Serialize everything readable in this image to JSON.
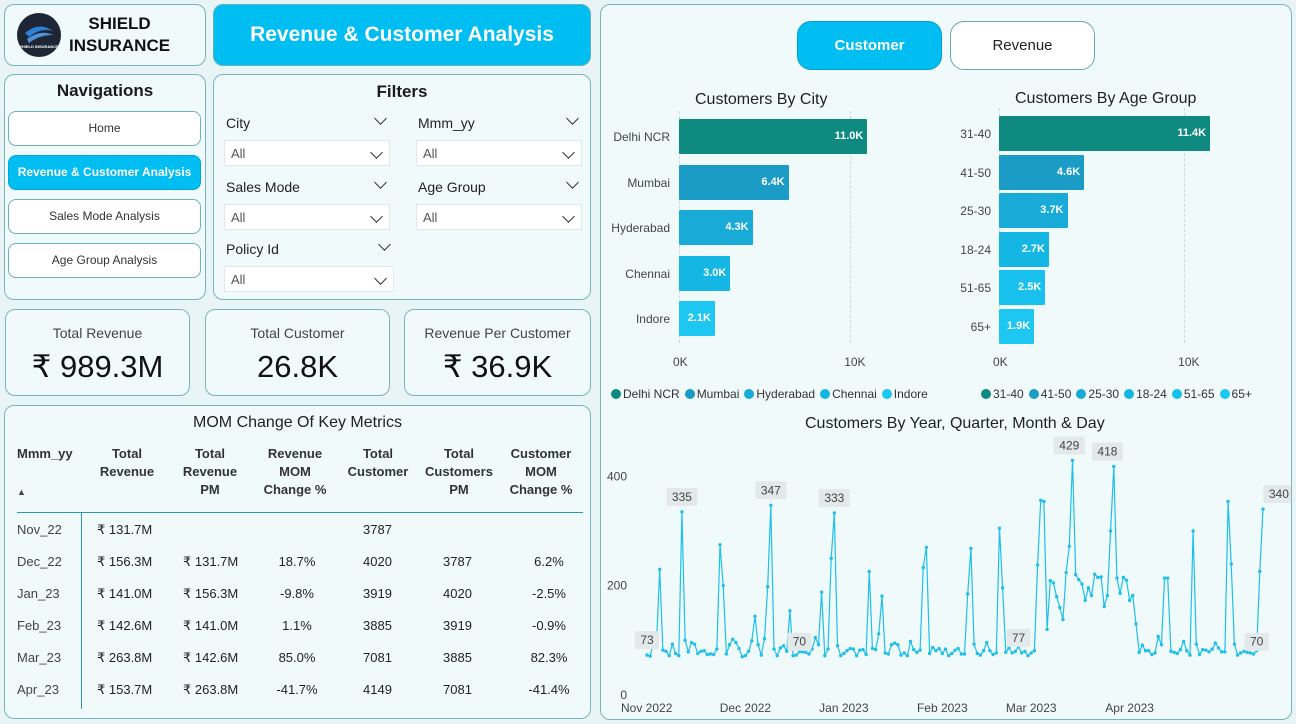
{
  "brand": {
    "name_line1": "SHIELD",
    "name_line2": "INSURANCE",
    "logo_text": "SHIELD INSURANCE"
  },
  "header": {
    "title": "Revenue & Customer Analysis"
  },
  "navigation": {
    "title": "Navigations",
    "items": [
      "Home",
      "Revenue & Customer Analysis",
      "Sales Mode Analysis",
      "Age Group Analysis"
    ],
    "active_index": 1
  },
  "filters": {
    "title": "Filters",
    "city": {
      "label": "City",
      "value": "All"
    },
    "mmm_yy": {
      "label": "Mmm_yy",
      "value": "All"
    },
    "sales_mode": {
      "label": "Sales Mode",
      "value": "All"
    },
    "age_group": {
      "label": "Age Group",
      "value": "All"
    },
    "policy_id": {
      "label": "Policy Id",
      "value": "All"
    }
  },
  "kpis": [
    {
      "label": "Total Revenue",
      "value": "₹ 989.3M"
    },
    {
      "label": "Total Customer",
      "value": "26.8K"
    },
    {
      "label": "Revenue Per Customer",
      "value": "₹ 36.9K"
    }
  ],
  "mom_table": {
    "title": "MOM Change Of Key Metrics",
    "columns": [
      "Mmm_yy",
      "Total Revenue",
      "Total Revenue PM",
      "Revenue MOM Change %",
      "Total Customer",
      "Total Customers PM",
      "Customer MOM Change %"
    ],
    "rows": [
      [
        "Nov_22",
        "₹ 131.7M",
        "",
        "",
        "3787",
        "",
        ""
      ],
      [
        "Dec_22",
        "₹ 156.3M",
        "₹ 131.7M",
        "18.7%",
        "4020",
        "3787",
        "6.2%"
      ],
      [
        "Jan_23",
        "₹ 141.0M",
        "₹ 156.3M",
        "-9.8%",
        "3919",
        "4020",
        "-2.5%"
      ],
      [
        "Feb_23",
        "₹ 142.6M",
        "₹ 141.0M",
        "1.1%",
        "3885",
        "3919",
        "-0.9%"
      ],
      [
        "Mar_23",
        "₹ 263.8M",
        "₹ 142.6M",
        "85.0%",
        "7081",
        "3885",
        "82.3%"
      ],
      [
        "Apr_23",
        "₹ 153.7M",
        "₹ 263.8M",
        "-41.7%",
        "4149",
        "7081",
        "-41.4%"
      ]
    ]
  },
  "toggles": {
    "customer": "Customer",
    "revenue": "Revenue",
    "active": "customer"
  },
  "colors": {
    "accent": "#00bdf2",
    "teal": "#0f8a80",
    "blue": "#1fa3c9",
    "cyan": "#1ec0ea"
  },
  "chart_data": [
    {
      "type": "bar",
      "title": "Customers By City",
      "orientation": "horizontal",
      "categories": [
        "Delhi NCR",
        "Mumbai",
        "Hyderabad",
        "Chennai",
        "Indore"
      ],
      "values": [
        11.0,
        6.4,
        4.3,
        3.0,
        2.1
      ],
      "value_labels": [
        "11.0K",
        "6.4K",
        "4.3K",
        "3.0K",
        "2.1K"
      ],
      "xlim": [
        0,
        12.5
      ],
      "xticks": [
        "0K",
        "10K"
      ],
      "colors": [
        "#0f8a80",
        "#1a9cc6",
        "#18abd8",
        "#14b7e4",
        "#1ec6f2"
      ],
      "legend": [
        "Delhi NCR",
        "Mumbai",
        "Hyderabad",
        "Chennai",
        "Indore"
      ]
    },
    {
      "type": "bar",
      "title": "Customers By Age Group",
      "orientation": "horizontal",
      "categories": [
        "31-40",
        "41-50",
        "25-30",
        "18-24",
        "51-65",
        "65+"
      ],
      "values": [
        11.4,
        4.6,
        3.7,
        2.7,
        2.5,
        1.9
      ],
      "value_labels": [
        "11.4K",
        "4.6K",
        "3.7K",
        "2.7K",
        "2.5K",
        "1.9K"
      ],
      "xlim": [
        0,
        13.5
      ],
      "xticks": [
        "0K",
        "10K"
      ],
      "colors": [
        "#0f8a80",
        "#1a9cc6",
        "#18abd8",
        "#14b7e4",
        "#18c0ee",
        "#1ec6f2"
      ],
      "legend": [
        "31-40",
        "41-50",
        "25-30",
        "18-24",
        "51-65",
        "65+"
      ]
    },
    {
      "type": "line",
      "title": "Customers By Year, Quarter, Month & Day",
      "ylim": [
        0,
        450
      ],
      "yticks": [
        "0",
        "200",
        "400"
      ],
      "xticks": [
        "Nov 2022",
        "Dec 2022",
        "Jan 2023",
        "Feb 2023",
        "Mar 2023",
        "Apr 2023"
      ],
      "values": [
        73,
        71,
        95,
        94,
        230,
        82,
        80,
        72,
        93,
        76,
        72,
        335,
        100,
        79,
        96,
        93,
        76,
        80,
        81,
        74,
        75,
        74,
        84,
        275,
        200,
        75,
        92,
        102,
        96,
        85,
        70,
        72,
        80,
        99,
        144,
        92,
        73,
        103,
        198,
        347,
        84,
        72,
        86,
        90,
        80,
        154,
        72,
        73,
        79,
        79,
        78,
        75,
        84,
        105,
        92,
        188,
        72,
        84,
        250,
        333,
        90,
        72,
        76,
        81,
        85,
        84,
        72,
        82,
        83,
        74,
        226,
        85,
        83,
        112,
        181,
        77,
        75,
        92,
        95,
        92,
        73,
        77,
        72,
        98,
        83,
        78,
        82,
        233,
        270,
        76,
        87,
        81,
        85,
        76,
        84,
        72,
        76,
        82,
        85,
        75,
        75,
        185,
        268,
        93,
        76,
        73,
        81,
        96,
        81,
        74,
        77,
        305,
        196,
        78,
        86,
        77,
        80,
        88,
        77,
        80,
        72,
        77,
        81,
        238,
        356,
        354,
        120,
        209,
        205,
        180,
        160,
        138,
        224,
        272,
        429,
        220,
        211,
        203,
        173,
        196,
        182,
        221,
        215,
        216,
        162,
        182,
        300,
        418,
        214,
        186,
        215,
        210,
        173,
        182,
        130,
        78,
        91,
        81,
        81,
        74,
        77,
        107,
        92,
        214,
        214,
        80,
        78,
        76,
        83,
        98,
        81,
        73,
        300,
        93,
        74,
        83,
        82,
        79,
        84,
        95,
        86,
        79,
        79,
        354,
        240,
        93,
        73,
        77,
        80,
        78,
        77,
        75,
        81,
        226,
        340
      ],
      "point_labels": [
        "73",
        "335",
        "70",
        "347",
        "333",
        "77",
        "429",
        "418",
        "70",
        "340"
      ]
    }
  ]
}
